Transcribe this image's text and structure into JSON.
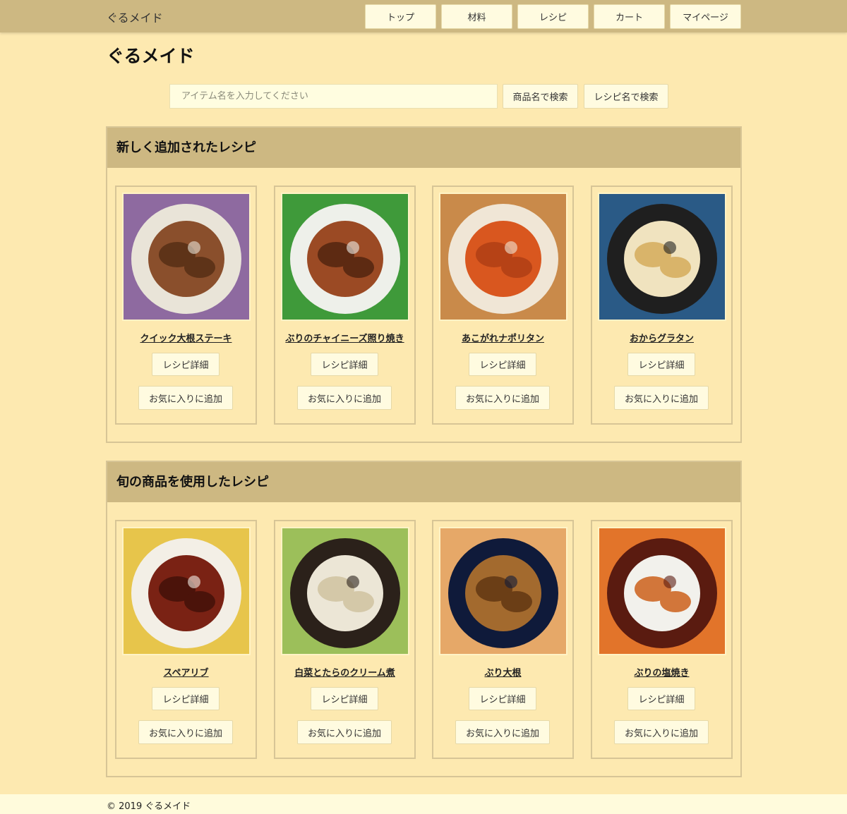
{
  "nav": {
    "brand": "ぐるメイド",
    "items": [
      "トップ",
      "材料",
      "レシピ",
      "カート",
      "マイページ"
    ]
  },
  "page_title": "ぐるメイド",
  "search": {
    "placeholder": "アイテム名を入力してください",
    "value": "",
    "product_button": "商品名で検索",
    "recipe_button": "レシピ名で検索"
  },
  "sections": [
    {
      "title": "新しく追加されたレシピ",
      "cards": [
        {
          "name": "クイック大根ステーキ",
          "detail": "レシピ詳細",
          "favorite": "お気に入りに追加",
          "palette": [
            "#e9e4d8",
            "#8a4f2c",
            "#5e3318",
            "#8e6aa0"
          ]
        },
        {
          "name": "ぶりのチャイニーズ照り焼き",
          "detail": "レシピ詳細",
          "favorite": "お気に入りに追加",
          "palette": [
            "#eef0ea",
            "#9b4a24",
            "#5d2a12",
            "#3f9a3a"
          ]
        },
        {
          "name": "あこがれナポリタン",
          "detail": "レシピ詳細",
          "favorite": "お気に入りに追加",
          "palette": [
            "#f0e6d6",
            "#d9571f",
            "#b64216",
            "#c98a4a"
          ]
        },
        {
          "name": "おからグラタン",
          "detail": "レシピ詳細",
          "favorite": "お気に入りに追加",
          "palette": [
            "#1f1f1f",
            "#f0e3bf",
            "#d9b46a",
            "#2a5a86"
          ]
        }
      ]
    },
    {
      "title": "旬の商品を使用したレシピ",
      "cards": [
        {
          "name": "スペアリブ",
          "detail": "レシピ詳細",
          "favorite": "お気に入りに追加",
          "palette": [
            "#f3efe6",
            "#7a2214",
            "#4b130a",
            "#e7c54b"
          ]
        },
        {
          "name": "白菜とたらのクリーム煮",
          "detail": "レシピ詳細",
          "favorite": "お気に入りに追加",
          "palette": [
            "#2b211a",
            "#ece6d6",
            "#d4c8a8",
            "#9cbf5a"
          ]
        },
        {
          "name": "ぶり大根",
          "detail": "レシピ詳細",
          "favorite": "お気に入りに追加",
          "palette": [
            "#0f1a3a",
            "#a36a2e",
            "#6b3e16",
            "#e6a868"
          ]
        },
        {
          "name": "ぶりの塩焼き",
          "detail": "レシピ詳細",
          "favorite": "お気に入りに追加",
          "palette": [
            "#5a1b10",
            "#f2f1ec",
            "#d2763a",
            "#e2742a"
          ]
        }
      ]
    }
  ],
  "footer": {
    "copyright": "© 2019 ぐるメイド"
  }
}
